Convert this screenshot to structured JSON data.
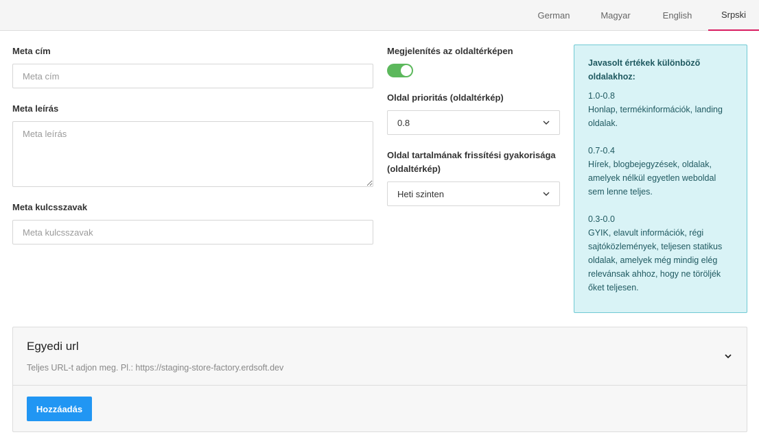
{
  "languages": [
    "German",
    "Magyar",
    "English",
    "Srpski"
  ],
  "active_language": "Srpski",
  "meta_title": {
    "label": "Meta cím",
    "placeholder": "Meta cím",
    "value": ""
  },
  "meta_description": {
    "label": "Meta leírás",
    "placeholder": "Meta leírás",
    "value": ""
  },
  "meta_keywords": {
    "label": "Meta kulcsszavak",
    "placeholder": "Meta kulcsszavak",
    "value": ""
  },
  "sitemap_display": {
    "label": "Megjelenítés az oldaltérképen",
    "enabled": true
  },
  "priority": {
    "label": "Oldal prioritás (oldaltérkép)",
    "value": "0.8"
  },
  "frequency": {
    "label_line1": "Oldal tartalmának frissítési gyakorisága",
    "label_line2": "(oldaltérkép)",
    "value": "Heti szinten"
  },
  "hint": {
    "title_line1": "Javasolt értékek különböző",
    "title_line2": "oldalakhoz:",
    "blocks": [
      {
        "range": "1.0-0.8",
        "lines": [
          "Honlap, termékinformációk, landing",
          "oldalak."
        ]
      },
      {
        "range": "0.7-0.4",
        "lines": [
          "Hírek, blogbejegyzések, oldalak,",
          "amelyek nélkül egyetlen weboldal",
          "sem lenne teljes."
        ]
      },
      {
        "range": "0.3-0.0",
        "lines": [
          "GYIK, elavult információk, régi",
          "sajtóközlemények, teljesen statikus",
          "oldalak, amelyek még mindig elég",
          "relevánsak ahhoz, hogy ne töröljék",
          "őket teljesen."
        ]
      }
    ]
  },
  "custom_url": {
    "title": "Egyedi url",
    "subtitle": "Teljes URL-t adjon meg. Pl.: https://staging-store-factory.erdsoft.dev",
    "add_label": "Hozzáadás"
  },
  "colors": {
    "accent_tab": "#d81b60",
    "toggle_on": "#5cb85c",
    "button": "#2196f3",
    "hint_bg": "#d9f3f6"
  }
}
